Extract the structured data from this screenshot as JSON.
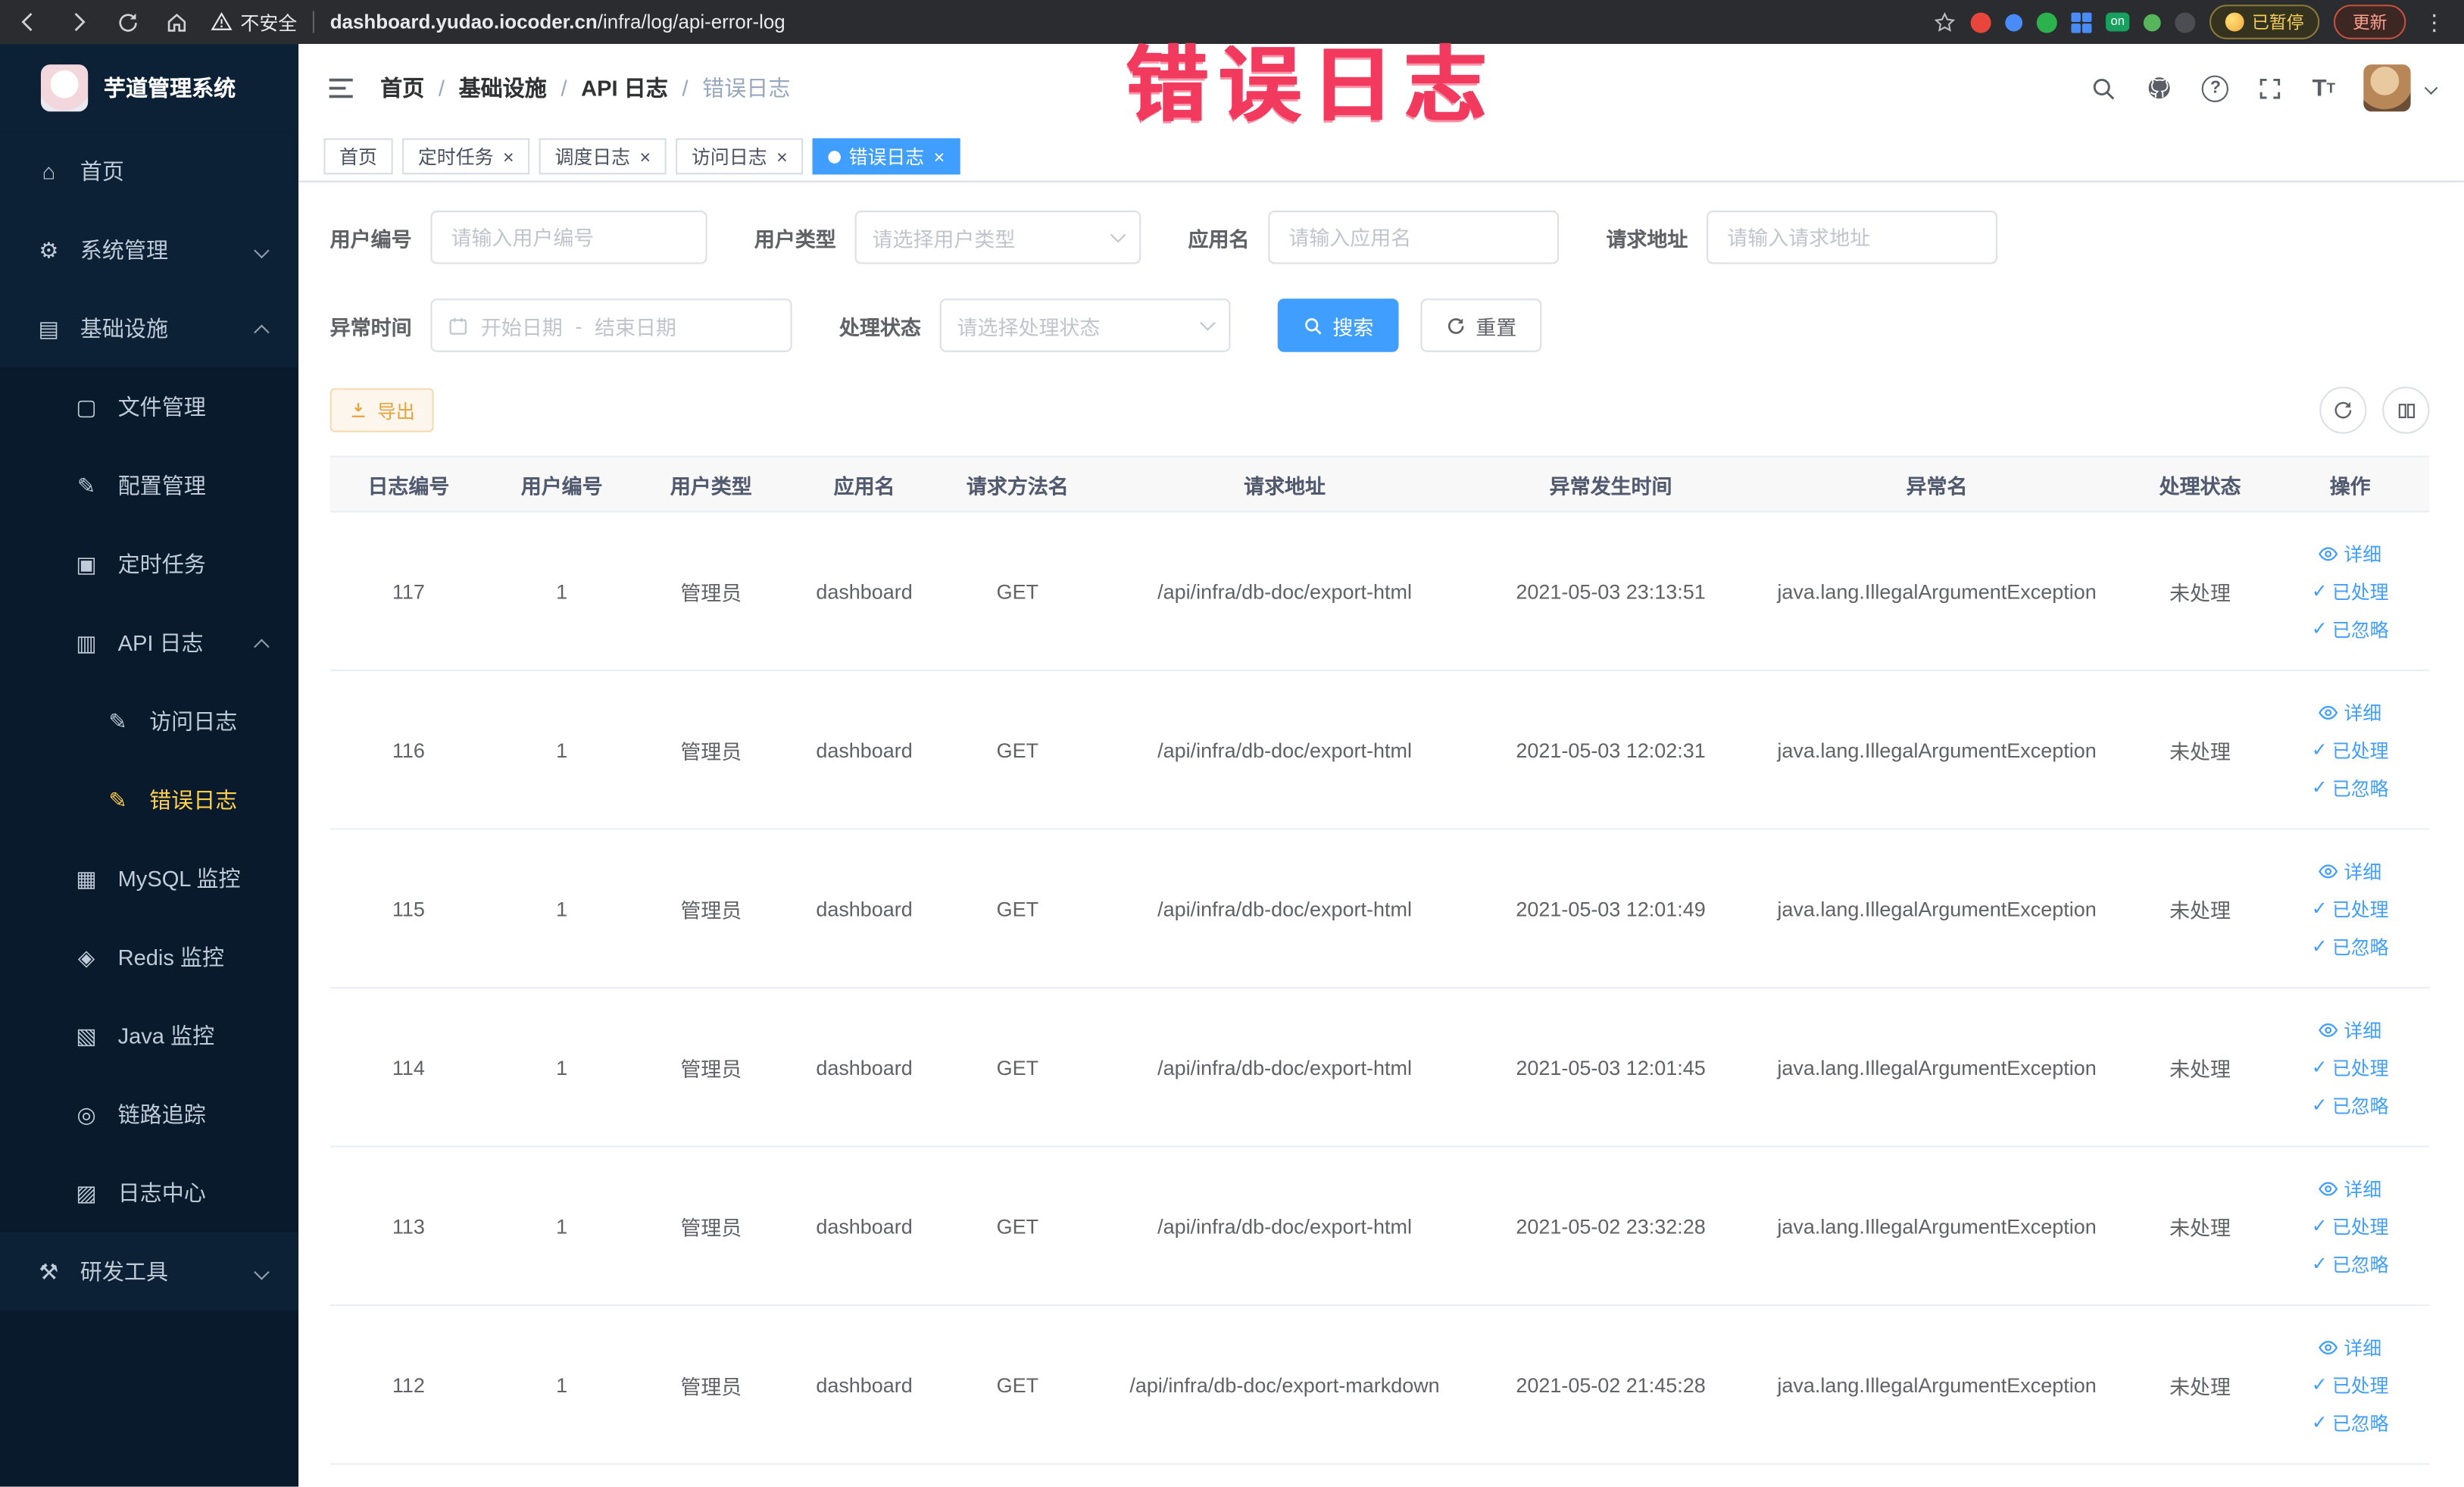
{
  "accent_colors": {
    "primary": "#409EFF",
    "warning": "#E6A23C",
    "menu_active": "#ffd04b",
    "annotation": "#F23A5E"
  },
  "browser": {
    "security_label": "不安全",
    "url_domain": "dashboard.yudao.iocoder.cn",
    "url_path": "/infra/log/api-error-log",
    "on_badge": "on",
    "paused_label": "已暂停",
    "update_label": "更新"
  },
  "annotation_text": "错误日志",
  "sidebar": {
    "title": "芋道管理系统",
    "items": [
      {
        "label": "首页",
        "icon": "home-icon",
        "level": 1
      },
      {
        "label": "系统管理",
        "icon": "gear-icon",
        "level": 1,
        "arrow": "down"
      },
      {
        "label": "基础设施",
        "icon": "infrastructure-icon",
        "level": 1,
        "arrow": "up"
      },
      {
        "label": "文件管理",
        "icon": "file-manage-icon",
        "level": 2
      },
      {
        "label": "配置管理",
        "icon": "config-manage-icon",
        "level": 2
      },
      {
        "label": "定时任务",
        "icon": "scheduled-task-icon",
        "level": 2
      },
      {
        "label": "API 日志",
        "icon": "api-log-icon",
        "level": 2,
        "arrow": "up"
      },
      {
        "label": "访问日志",
        "icon": "access-log-icon",
        "level": 3
      },
      {
        "label": "错误日志",
        "icon": "error-log-icon",
        "level": 3,
        "active": true
      },
      {
        "label": "MySQL 监控",
        "icon": "mysql-monitor-icon",
        "level": 2
      },
      {
        "label": "Redis 监控",
        "icon": "redis-monitor-icon",
        "level": 2
      },
      {
        "label": "Java 监控",
        "icon": "java-monitor-icon",
        "level": 2
      },
      {
        "label": "链路追踪",
        "icon": "trace-icon",
        "level": 2
      },
      {
        "label": "日志中心",
        "icon": "log-center-icon",
        "level": 2
      },
      {
        "label": "研发工具",
        "icon": "dev-tools-icon",
        "level": 1,
        "arrow": "down"
      }
    ]
  },
  "breadcrumb": {
    "items": [
      "首页",
      "基础设施",
      "API 日志",
      "错误日志"
    ]
  },
  "tags": [
    {
      "label": "首页",
      "active": false,
      "closable": false
    },
    {
      "label": "定时任务",
      "active": false,
      "closable": true
    },
    {
      "label": "调度日志",
      "active": false,
      "closable": true
    },
    {
      "label": "访问日志",
      "active": false,
      "closable": true
    },
    {
      "label": "错误日志",
      "active": true,
      "closable": true
    }
  ],
  "filters": {
    "user_id_label": "用户编号",
    "user_id_placeholder": "请输入用户编号",
    "user_type_label": "用户类型",
    "user_type_placeholder": "请选择用户类型",
    "app_name_label": "应用名",
    "app_name_placeholder": "请输入应用名",
    "request_url_label": "请求地址",
    "request_url_placeholder": "请输入请求地址",
    "exception_time_label": "异常时间",
    "start_date_placeholder": "开始日期",
    "range_separator": "-",
    "end_date_placeholder": "结束日期",
    "process_status_label": "处理状态",
    "process_status_placeholder": "请选择处理状态",
    "search_button": "搜索",
    "reset_button": "重置"
  },
  "toolbar": {
    "export_button": "导出"
  },
  "table": {
    "headers": [
      "日志编号",
      "用户编号",
      "用户类型",
      "应用名",
      "请求方法名",
      "请求地址",
      "异常发生时间",
      "异常名",
      "处理状态",
      "操作"
    ],
    "actions": [
      "详细",
      "已处理",
      "已忽略"
    ],
    "rows": [
      {
        "log_id": "117",
        "user_id": "1",
        "user_type": "管理员",
        "app_name": "dashboard",
        "method": "GET",
        "url": "/api/infra/db-doc/export-html",
        "time": "2021-05-03 23:13:51",
        "exception": "java.lang.IllegalArgumentException",
        "status": "未处理"
      },
      {
        "log_id": "116",
        "user_id": "1",
        "user_type": "管理员",
        "app_name": "dashboard",
        "method": "GET",
        "url": "/api/infra/db-doc/export-html",
        "time": "2021-05-03 12:02:31",
        "exception": "java.lang.IllegalArgumentException",
        "status": "未处理"
      },
      {
        "log_id": "115",
        "user_id": "1",
        "user_type": "管理员",
        "app_name": "dashboard",
        "method": "GET",
        "url": "/api/infra/db-doc/export-html",
        "time": "2021-05-03 12:01:49",
        "exception": "java.lang.IllegalArgumentException",
        "status": "未处理"
      },
      {
        "log_id": "114",
        "user_id": "1",
        "user_type": "管理员",
        "app_name": "dashboard",
        "method": "GET",
        "url": "/api/infra/db-doc/export-html",
        "time": "2021-05-03 12:01:45",
        "exception": "java.lang.IllegalArgumentException",
        "status": "未处理"
      },
      {
        "log_id": "113",
        "user_id": "1",
        "user_type": "管理员",
        "app_name": "dashboard",
        "method": "GET",
        "url": "/api/infra/db-doc/export-html",
        "time": "2021-05-02 23:32:28",
        "exception": "java.lang.IllegalArgumentException",
        "status": "未处理"
      },
      {
        "log_id": "112",
        "user_id": "1",
        "user_type": "管理员",
        "app_name": "dashboard",
        "method": "GET",
        "url": "/api/infra/db-doc/export-markdown",
        "time": "2021-05-02 21:45:28",
        "exception": "java.lang.IllegalArgumentException",
        "status": "未处理"
      }
    ]
  }
}
